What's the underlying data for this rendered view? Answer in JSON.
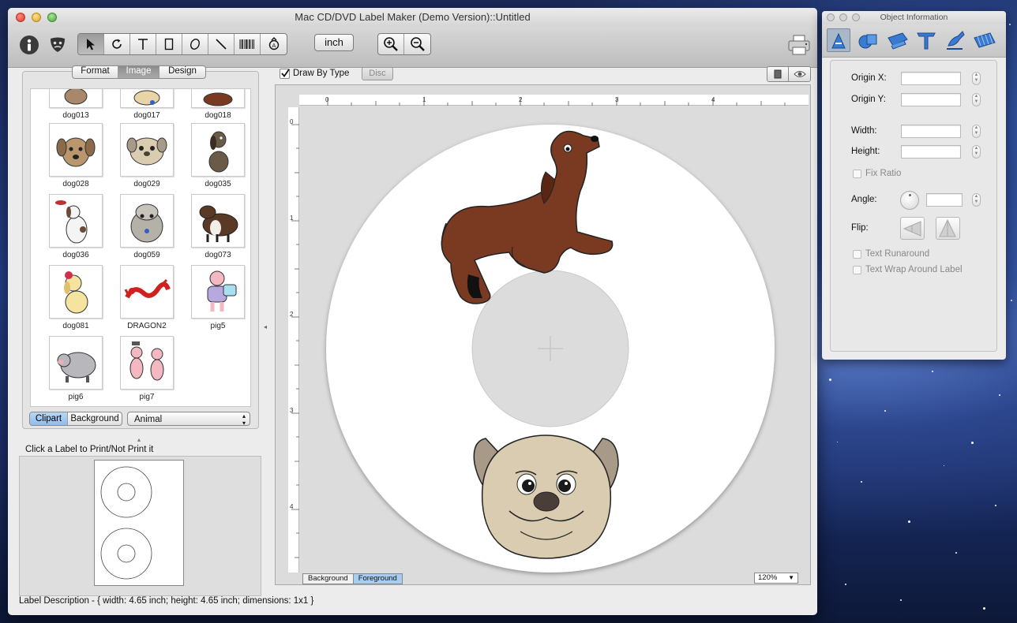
{
  "window": {
    "title": "Mac CD/DVD Label Maker (Demo Version)::Untitled"
  },
  "toolbar": {
    "unit_label": "inch",
    "tools": [
      {
        "name": "select-tool",
        "icon": "arrow-pointer-icon"
      },
      {
        "name": "rotate-tool",
        "icon": "rotate-icon"
      },
      {
        "name": "text-tool",
        "icon": "text-icon"
      },
      {
        "name": "rectangle-tool",
        "icon": "rectangle-icon"
      },
      {
        "name": "ellipse-tool",
        "icon": "ellipse-icon"
      },
      {
        "name": "line-tool",
        "icon": "line-icon"
      },
      {
        "name": "barcode-tool",
        "icon": "barcode-icon"
      },
      {
        "name": "curved-text-tool",
        "icon": "curved-text-icon"
      }
    ]
  },
  "left_panel": {
    "tabs": [
      "Format",
      "Image",
      "Design"
    ],
    "selected_tab": "Image",
    "clipart": [
      {
        "label": "dog013"
      },
      {
        "label": "dog017"
      },
      {
        "label": "dog018"
      },
      {
        "label": "dog028"
      },
      {
        "label": "dog029"
      },
      {
        "label": "dog035"
      },
      {
        "label": "dog036"
      },
      {
        "label": "dog059"
      },
      {
        "label": "dog073"
      },
      {
        "label": "dog081"
      },
      {
        "label": "DRAGON2"
      },
      {
        "label": "pig5"
      },
      {
        "label": "pig6"
      },
      {
        "label": "pig7"
      }
    ],
    "source_tabs": [
      "Clipart",
      "Background"
    ],
    "selected_source": "Clipart",
    "category_value": "Animal",
    "print_note": "Click a Label to Print/Not Print it"
  },
  "canvas": {
    "draw_by_type_label": "Draw By Type",
    "draw_by_type_checked": true,
    "disc_button": "Disc",
    "ruler_top_numbers": [
      "0",
      "1",
      "2",
      "3",
      "4"
    ],
    "ruler_left_numbers": [
      "0",
      "1",
      "2",
      "3",
      "4"
    ],
    "layer_tabs": [
      "Background",
      "Foreground"
    ],
    "selected_layer": "Foreground",
    "zoom_value": "120%"
  },
  "status": {
    "label_description": "Label Description - { width: 4.65 inch; height: 4.65 inch; dimensions: 1x1 }"
  },
  "object_info": {
    "title": "Object Information",
    "fields": {
      "origin_x": "Origin X:",
      "origin_y": "Origin Y:",
      "width": "Width:",
      "height": "Height:",
      "fix_ratio": "Fix Ratio",
      "angle": "Angle:",
      "flip": "Flip:",
      "text_runaround": "Text Runaround",
      "text_wrap": "Text Wrap Around Label"
    }
  },
  "colors": {
    "dachshund": "#7a3a22",
    "pug_face": "#d9ccb0",
    "selection_blue": "#a9cdf1"
  }
}
